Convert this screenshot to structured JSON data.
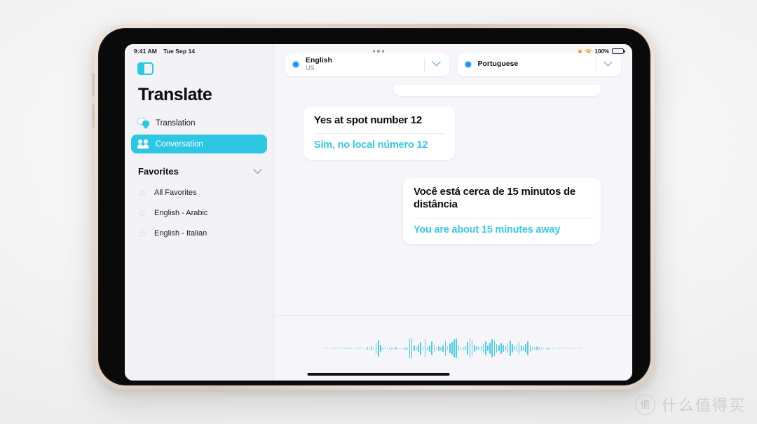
{
  "status_bar": {
    "time": "9:41 AM",
    "date": "Tue Sep 14",
    "battery_percent": "100%",
    "recording_indicator": "orange-record-dot",
    "wifi_icon": "wifi-icon",
    "multitask_handle": "three-dots-handle"
  },
  "sidebar": {
    "toggle_icon": "sidebar-toggle-icon",
    "app_title": "Translate",
    "nav_items": [
      {
        "label": "Translation",
        "icon": "speech-bubbles-icon",
        "active": false
      },
      {
        "label": "Conversation",
        "icon": "two-people-icon",
        "active": true
      }
    ],
    "favorites": {
      "header": "Favorites",
      "chevron_icon": "chevron-down-icon",
      "items": [
        {
          "label": "All Favorites",
          "icon": "star-icon"
        },
        {
          "label": "English - Arabic",
          "icon": "star-icon"
        },
        {
          "label": "English - Italian",
          "icon": "star-icon"
        }
      ]
    }
  },
  "language_bar": {
    "source": {
      "name": "English",
      "region": "US",
      "radio_icon": "selected-radio-dot",
      "chevron_icon": "chevron-down-icon"
    },
    "target": {
      "name": "Portuguese",
      "region": "",
      "radio_icon": "selected-radio-dot",
      "chevron_icon": "chevron-down-icon"
    }
  },
  "conversation": {
    "messages": [
      {
        "side": "left",
        "source_text": "Yes at spot number 12",
        "translated_text": "Sim, no local número 12"
      },
      {
        "side": "right",
        "source_text": "Você está cerca de 15 minutos de distância",
        "translated_text": "You are about 15 minutes away"
      }
    ]
  },
  "mic_area": {
    "waveform_label": "audio-waveform",
    "waveform_heights": [
      1,
      1,
      1,
      1,
      2,
      1,
      1,
      2,
      1,
      1,
      2,
      1,
      1,
      2,
      1,
      2,
      1,
      1,
      2,
      4,
      2,
      6,
      3,
      16,
      24,
      10,
      3,
      2,
      2,
      4,
      3,
      2,
      4,
      2,
      1,
      2,
      3,
      3,
      28,
      30,
      8,
      4,
      10,
      18,
      6,
      26,
      5,
      9,
      20,
      10,
      4,
      7,
      5,
      9,
      22,
      6,
      14,
      18,
      26,
      28,
      8,
      4,
      3,
      6,
      18,
      28,
      22,
      10,
      6,
      4,
      7,
      12,
      20,
      8,
      16,
      26,
      22,
      12,
      8,
      16,
      10,
      7,
      14,
      22,
      12,
      6,
      10,
      18,
      8,
      5,
      12,
      20,
      9,
      5,
      3,
      6,
      4,
      3,
      2,
      2,
      3,
      2,
      2,
      1,
      1,
      2,
      1,
      1,
      2,
      1,
      1,
      1,
      1,
      1,
      1,
      1
    ]
  },
  "colors": {
    "accent_cyan": "#2ec7e3",
    "translated_text": "#3cc7e0",
    "radio_blue": "#2196f3",
    "sidebar_bg": "#f2f2f7",
    "content_bg": "#f5f5fa",
    "bubble_bg": "#ffffff"
  },
  "watermark": {
    "badge_glyph": "值",
    "text": "什么值得买"
  }
}
